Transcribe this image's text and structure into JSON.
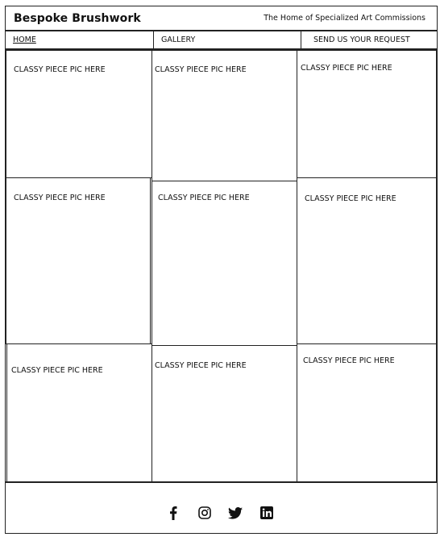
{
  "header": {
    "brand": "Bespoke Brushwork",
    "tagline": "The Home of Specialized Art Commissions"
  },
  "nav": {
    "home": "HOME",
    "gallery": "GALLERY",
    "request": "SEND US YOUR REQUEST"
  },
  "gallery": {
    "placeholder": "CLASSY PIECE PIC HERE"
  },
  "footer": {
    "social_icons": [
      "facebook-icon",
      "instagram-icon",
      "twitter-icon",
      "linkedin-icon"
    ]
  }
}
